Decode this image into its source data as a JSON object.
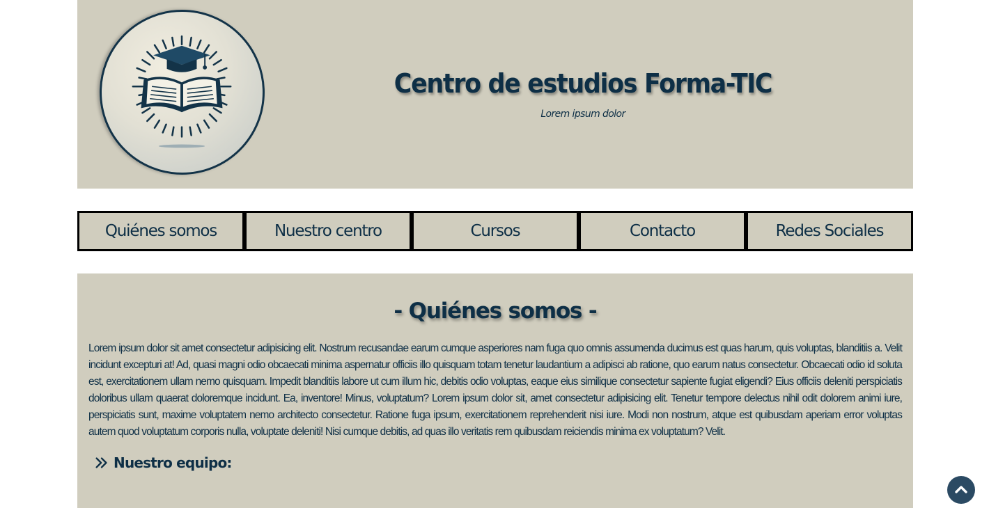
{
  "header": {
    "title": "Centro de estudios Forma-TIC",
    "subtitle": "Lorem ipsum dolor",
    "logo_icon": "graduation-cap-book-logo"
  },
  "nav": {
    "items": [
      {
        "label": "Quiénes somos"
      },
      {
        "label": "Nuestro centro"
      },
      {
        "label": "Cursos"
      },
      {
        "label": "Contacto"
      },
      {
        "label": "Redes Sociales"
      }
    ]
  },
  "main": {
    "section_title": "- Quiénes somos -",
    "body": "Lorem ipsum dolor sit amet consectetur adipisicing elit. Nostrum recusandae earum cumque asperiores nam fuga quo omnis assumenda ducimus est quas harum, quis voluptas, blanditiis a. Velit incidunt excepturi at! Ad, quasi magni odio obcaecati minima aspernatur officiis illo quisquam totam tenetur laudantium a adipisci ab ratione, quo earum natus consectetur. Obcaecati odio id soluta est, exercitationem ullam nemo quisquam. Impedit blanditiis labore ut cum illum hic, debitis odio voluptas, eaque eius similique consectetur sapiente fugiat eligendi? Eius officiis deleniti perspiciatis doloribus ullam quaerat doloremque incidunt. Ea, inventore! Minus, voluptatum? Lorem ipsum dolor sit, amet consectetur adipisicing elit. Tenetur tempore delectus nihil odit dolorem animi iure, perspiciatis sunt, maxime voluptatem nemo architecto consectetur. Ratione fuga ipsum, exercitationem reprehenderit nisi iure. Modi non nostrum, atque est quibusdam aperiam error voluptas autem quod voluptatum corporis nulla, voluptate deleniti! Nisi cumque debitis, ad quas illo veritatis rem quibusdam reiciendis minima ex voluptatum? Velit.",
    "team_heading": "Nuestro equipo:",
    "team_icon": "double-chevron-right-icon"
  },
  "scroll_top": {
    "icon": "chevron-up-icon"
  },
  "colors": {
    "panel_bg": "#d0cdbe",
    "text": "#0e2f46",
    "border": "#000000",
    "scroll_button": "#2b4a63"
  }
}
